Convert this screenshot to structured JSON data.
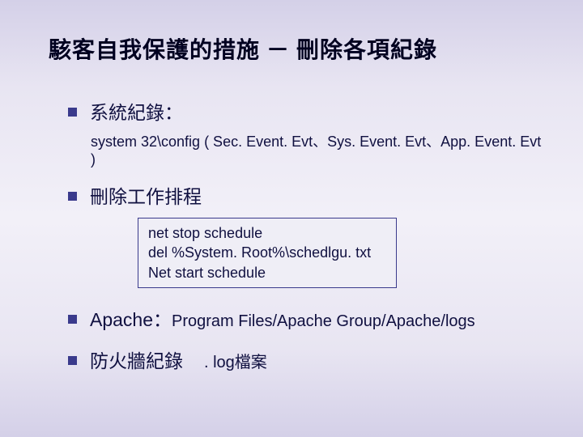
{
  "title": "駭客自我保護的措施 － 刪除各項紀錄",
  "bullets": {
    "b1": "系統紀錄：",
    "b1_sub": "system 32\\config ( Sec. Event. Evt、Sys. Event. Evt、App. Event. Evt )",
    "b2": "刪除工作排程",
    "code_l1": "net  stop  schedule",
    "code_l2": "del  %System. Root%\\schedlgu. txt",
    "code_l3": "Net  start  schedule",
    "b3_label": "Apache：",
    "b3_path": "Program Files/Apache Group/Apache/logs",
    "b4_label": "防火牆紀錄",
    "b4_ext": ". log檔案"
  }
}
